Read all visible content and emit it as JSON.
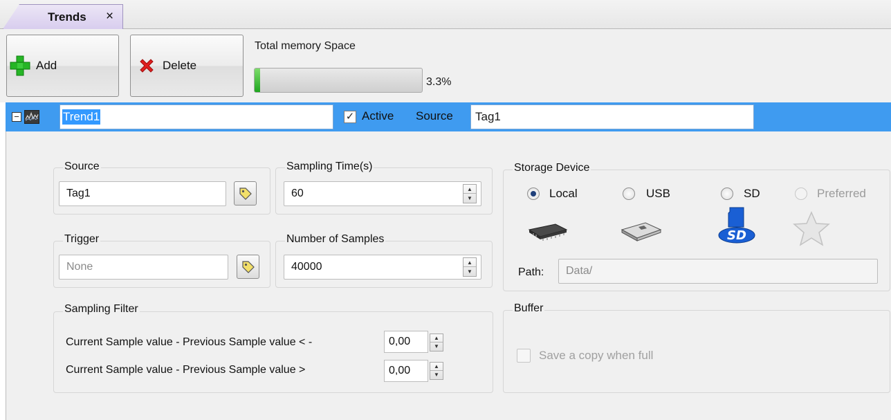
{
  "tab": {
    "title": "Trends",
    "close_glyph": "×"
  },
  "toolbar": {
    "add_label": "Add",
    "delete_label": "Delete",
    "memory_title": "Total memory Space",
    "memory_percent_text": "3.3%",
    "memory_fraction": 0.033
  },
  "trend": {
    "name": "Trend1",
    "active_label": "Active",
    "active_checked": true,
    "source_label": "Source",
    "source_value": "Tag1"
  },
  "source_group": {
    "label": "Source",
    "value": "Tag1"
  },
  "sampling_time": {
    "label": "Sampling Time(s)",
    "value": "60"
  },
  "trigger_group": {
    "label": "Trigger",
    "value": "None"
  },
  "samples": {
    "label": "Number of Samples",
    "value": "40000"
  },
  "storage": {
    "label": "Storage Device",
    "options": [
      "Local",
      "USB",
      "SD",
      "Preferred"
    ],
    "selected": "Local",
    "path_label": "Path:",
    "path_value": "Data/"
  },
  "filter": {
    "label": "Sampling Filter",
    "row1_label": "Current Sample value - Previous Sample value < -",
    "row1_value": "0,00",
    "row2_label": "Current Sample value - Previous Sample value >",
    "row2_value": "0,00"
  },
  "buffer": {
    "label": "Buffer",
    "checkbox_label": "Save a copy when full"
  },
  "icons": {
    "add": "plus-icon",
    "delete": "x-icon",
    "tag": "tag-icon",
    "local": "chip-icon",
    "usb": "usb-drive-icon",
    "sd": "sd-card-icon",
    "preferred": "star-icon"
  },
  "colors": {
    "selection_row": "#3f9bf0",
    "progress_fill": "#1fa61f",
    "add_icon": "#26b526",
    "delete_icon": "#e02020",
    "tab": "#d8cdee"
  }
}
